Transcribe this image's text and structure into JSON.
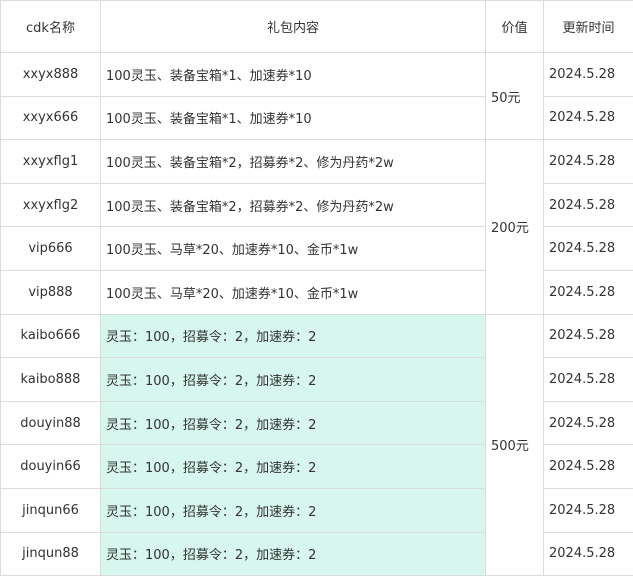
{
  "headers": {
    "code": "cdk名称",
    "content": "礼包内容",
    "price": "价值",
    "date": "更新时间"
  },
  "colors": {
    "highlight": "#d6f6ee",
    "border": "#dcdcdc"
  },
  "rows": [
    {
      "code": "xxyx888",
      "content": "100灵玉、装备宝箱*1、加速券*10",
      "date": "2024.5.28"
    },
    {
      "code": "xxyx666",
      "content": "100灵玉、装备宝箱*1、加速券*10",
      "date": "2024.5.28"
    },
    {
      "code": "xxyxflg1",
      "content": "100灵玉、装备宝箱*2，招募券*2、修为丹药*2w",
      "date": "2024.5.28"
    },
    {
      "code": "xxyxflg2",
      "content": "100灵玉、装备宝箱*2，招募券*2、修为丹药*2w",
      "date": "2024.5.28"
    },
    {
      "code": "vip666",
      "content": "100灵玉、马草*20、加速券*10、金币*1w",
      "date": "2024.5.28"
    },
    {
      "code": "vip888",
      "content": "100灵玉、马草*20、加速券*10、金币*1w",
      "date": "2024.5.28"
    },
    {
      "code": "kaibo666",
      "content": "灵玉：100，招募令：2，加速券：2",
      "date": "2024.5.28"
    },
    {
      "code": "kaibo888",
      "content": "灵玉：100，招募令：2，加速券：2",
      "date": "2024.5.28"
    },
    {
      "code": "douyin88",
      "content": "灵玉：100，招募令：2，加速券：2",
      "date": "2024.5.28"
    },
    {
      "code": "douyin66",
      "content": "灵玉：100，招募令：2，加速券：2",
      "date": "2024.5.28"
    },
    {
      "code": "jinqun66",
      "content": "灵玉：100，招募令：2，加速券：2",
      "date": "2024.5.28"
    },
    {
      "code": "jinqun88",
      "content": "灵玉：100，招募令：2，加速券：2",
      "date": "2024.5.28"
    }
  ],
  "prices": {
    "group1": "50元",
    "group2": "200元",
    "group3": "500元"
  }
}
